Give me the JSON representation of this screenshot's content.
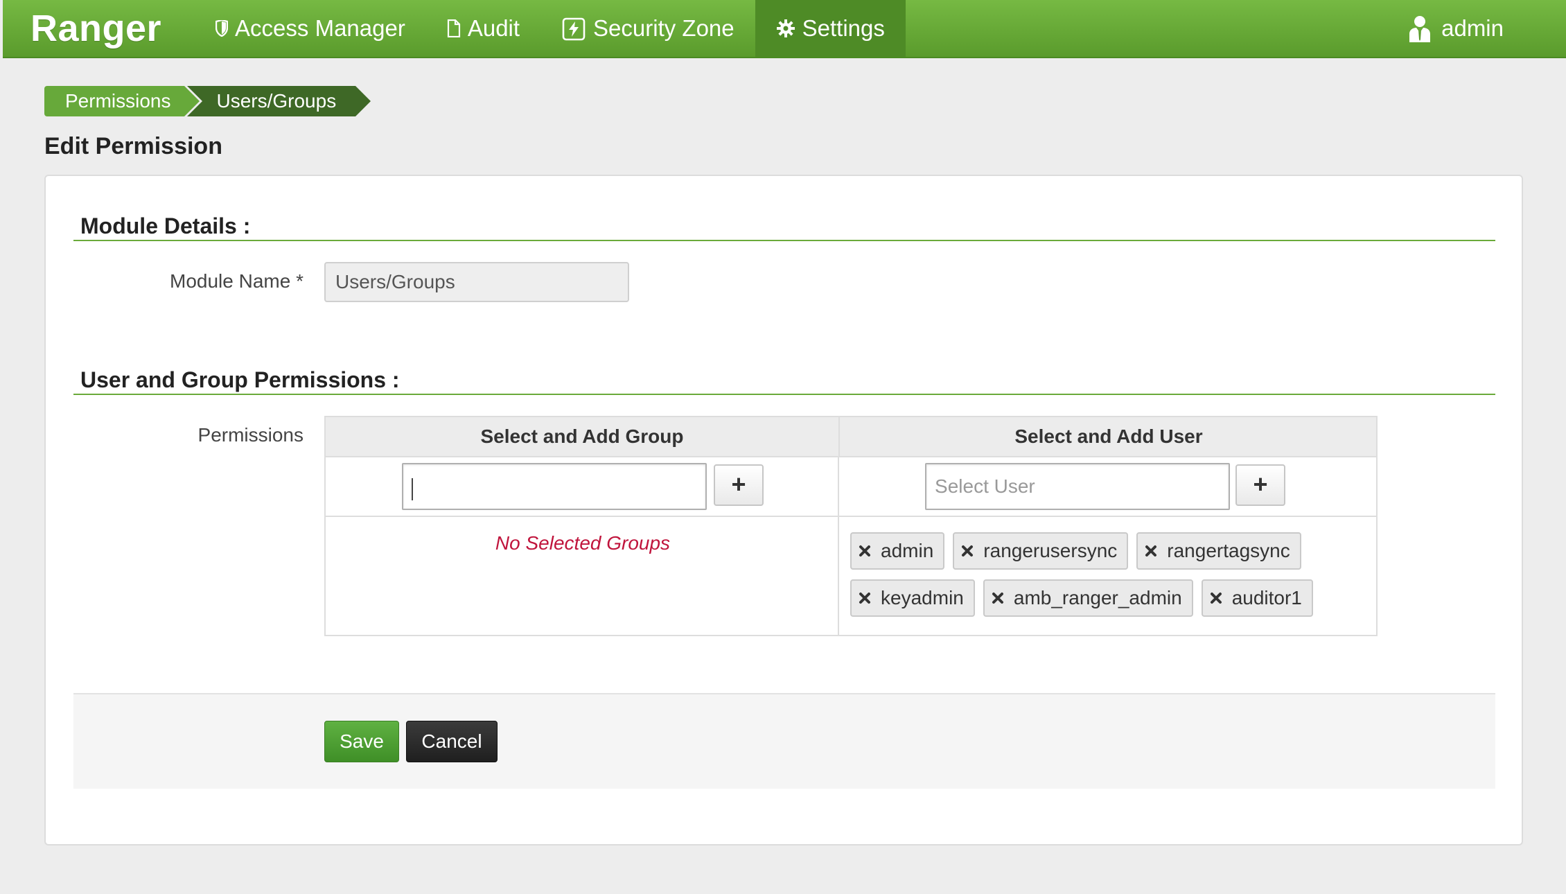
{
  "app": {
    "brand": "Ranger"
  },
  "nav": {
    "items": [
      {
        "label": "Access Manager",
        "icon": "shield-icon"
      },
      {
        "label": "Audit",
        "icon": "file-icon"
      },
      {
        "label": "Security Zone",
        "icon": "lightning-icon"
      },
      {
        "label": "Settings",
        "icon": "gear-icon",
        "active": true
      }
    ],
    "user": {
      "label": "admin",
      "icon": "user-icon"
    }
  },
  "breadcrumb": [
    "Permissions",
    "Users/Groups"
  ],
  "page": {
    "title": "Edit Permission"
  },
  "module_details": {
    "title": "Module Details :",
    "module_name_label": "Module Name *",
    "module_name_value": "Users/Groups"
  },
  "permissions": {
    "title": "User and Group Permissions :",
    "label": "Permissions",
    "group_header": "Select and Add Group",
    "user_header": "Select and Add User",
    "group_input_value": "",
    "user_input_placeholder": "Select User",
    "add_button_label": "+",
    "no_groups_text": "No Selected Groups",
    "selected_users": [
      "admin",
      "rangerusersync",
      "rangertagsync",
      "keyadmin",
      "amb_ranger_admin",
      "auditor1"
    ]
  },
  "actions": {
    "save_label": "Save",
    "cancel_label": "Cancel"
  },
  "colors": {
    "brand_green": "#6aaa3a",
    "active_nav": "#4e8b26",
    "breadcrumb_dark": "#3e6826",
    "error_red": "#c0143c"
  }
}
